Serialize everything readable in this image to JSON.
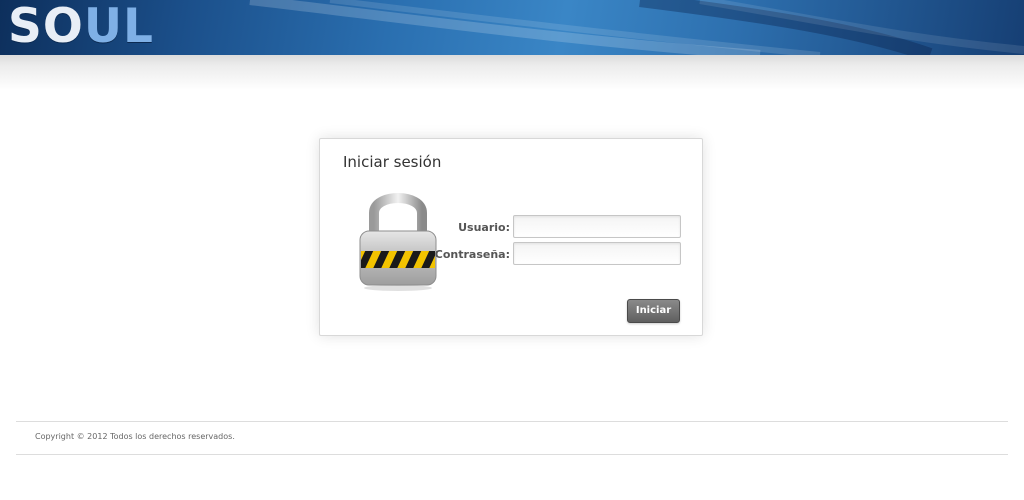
{
  "header": {
    "logo_part1": "SO",
    "logo_part2": "UL"
  },
  "login": {
    "title": "Iniciar sesión",
    "username_label": "Usuario:",
    "username_value": "",
    "password_label": "Contraseña:",
    "password_value": "",
    "submit_label": "Iniciar"
  },
  "footer": {
    "copyright": "Copyright © 2012 Todos los derechos reservados."
  },
  "colors": {
    "header_blue": "#2a6fb0",
    "button_gray": "#6f6f6f",
    "lock_yellow": "#f2c300"
  },
  "icons": {
    "lock": "padlock-icon"
  }
}
